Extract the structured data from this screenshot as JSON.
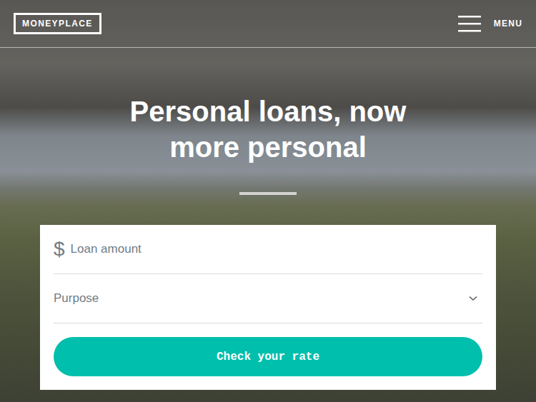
{
  "header": {
    "logo": "MONEYPLACE",
    "menu": {
      "label": "MENU"
    }
  },
  "hero": {
    "headline": "Personal loans, now more personal"
  },
  "form": {
    "amount": {
      "prefix": "$",
      "placeholder": "Loan amount"
    },
    "purpose": {
      "placeholder": "Purpose"
    },
    "button": "Check your rate"
  }
}
